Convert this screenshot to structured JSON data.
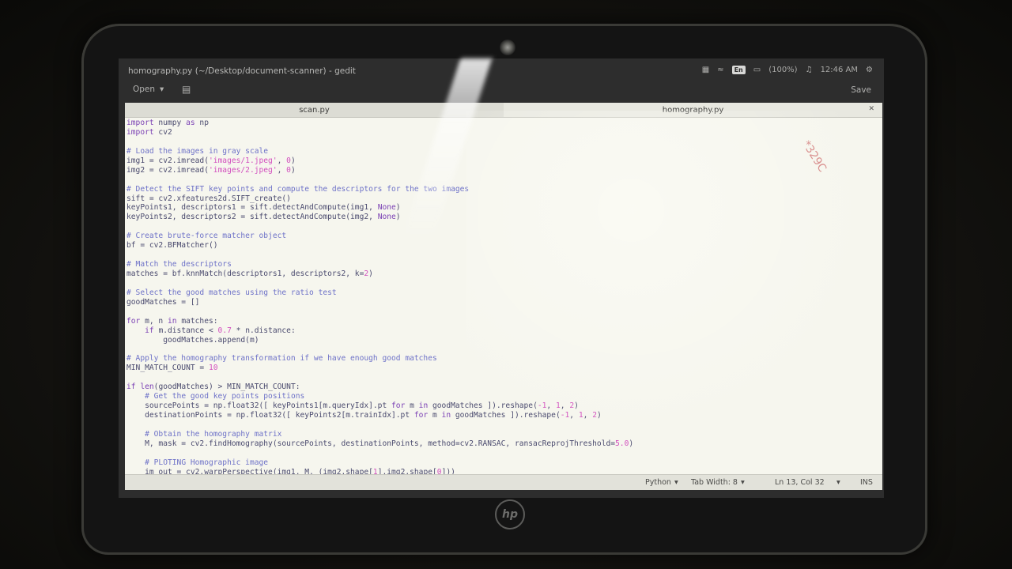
{
  "window": {
    "title": "homography.py (~/Desktop/document-scanner) - gedit"
  },
  "tray": {
    "lang": "En",
    "battery": "(100%)",
    "time": "12:46 AM",
    "icons": [
      "mail-icon",
      "wifi-icon",
      "battery-icon",
      "volume-icon",
      "power-icon"
    ]
  },
  "toolbar": {
    "open_label": "Open",
    "save_label": "Save"
  },
  "tabs": [
    {
      "label": "scan.py"
    },
    {
      "label": "homography.py"
    }
  ],
  "code_lines": [
    [
      [
        "kw",
        "import"
      ],
      [
        "p",
        " numpy "
      ],
      [
        "kw",
        "as"
      ],
      [
        "p",
        " np"
      ]
    ],
    [
      [
        "kw",
        "import"
      ],
      [
        "p",
        " cv2"
      ]
    ],
    [
      [
        "p",
        ""
      ]
    ],
    [
      [
        "cmt",
        "# Load the images in gray scale"
      ]
    ],
    [
      [
        "p",
        "img1 = cv2.imread("
      ],
      [
        "str",
        "'images/1.jpeg'"
      ],
      [
        "p",
        ", "
      ],
      [
        "num",
        "0"
      ],
      [
        "p",
        ")"
      ]
    ],
    [
      [
        "p",
        "img2 = cv2.imread("
      ],
      [
        "str",
        "'images/2.jpeg'"
      ],
      [
        "p",
        ", "
      ],
      [
        "num",
        "0"
      ],
      [
        "p",
        ")"
      ]
    ],
    [
      [
        "p",
        ""
      ]
    ],
    [
      [
        "cmt",
        "# Detect the SIFT key points and compute the descriptors for the two images"
      ]
    ],
    [
      [
        "p",
        "sift = cv2.xfeatures2d.SIFT_create()"
      ]
    ],
    [
      [
        "p",
        "keyPoints1, descriptors1 = sift.detectAndCompute(img1, "
      ],
      [
        "kw",
        "None"
      ],
      [
        "p",
        ")"
      ]
    ],
    [
      [
        "p",
        "keyPoints2, descriptors2 = sift.detectAndCompute(img2, "
      ],
      [
        "kw",
        "None"
      ],
      [
        "p",
        ")"
      ]
    ],
    [
      [
        "p",
        ""
      ]
    ],
    [
      [
        "cmt",
        "# Create brute-force matcher object"
      ]
    ],
    [
      [
        "p",
        "bf = cv2.BFMatcher()"
      ]
    ],
    [
      [
        "p",
        ""
      ]
    ],
    [
      [
        "cmt",
        "# Match the descriptors"
      ]
    ],
    [
      [
        "p",
        "matches = bf.knnMatch(descriptors1, descriptors2, k="
      ],
      [
        "num",
        "2"
      ],
      [
        "p",
        ")"
      ]
    ],
    [
      [
        "p",
        ""
      ]
    ],
    [
      [
        "cmt",
        "# Select the good matches using the ratio test"
      ]
    ],
    [
      [
        "p",
        "goodMatches = []"
      ]
    ],
    [
      [
        "p",
        ""
      ]
    ],
    [
      [
        "kw",
        "for"
      ],
      [
        "p",
        " m, n "
      ],
      [
        "kw",
        "in"
      ],
      [
        "p",
        " matches:"
      ]
    ],
    [
      [
        "p",
        "    "
      ],
      [
        "kw",
        "if"
      ],
      [
        "p",
        " m.distance < "
      ],
      [
        "num",
        "0.7"
      ],
      [
        "p",
        " * n.distance:"
      ]
    ],
    [
      [
        "p",
        "        goodMatches.append(m)"
      ]
    ],
    [
      [
        "p",
        ""
      ]
    ],
    [
      [
        "cmt",
        "# Apply the homography transformation if we have enough good matches"
      ]
    ],
    [
      [
        "p",
        "MIN_MATCH_COUNT = "
      ],
      [
        "num",
        "10"
      ]
    ],
    [
      [
        "p",
        ""
      ]
    ],
    [
      [
        "kw",
        "if"
      ],
      [
        "p",
        " "
      ],
      [
        "kw",
        "len"
      ],
      [
        "p",
        "(goodMatches) > MIN_MATCH_COUNT:"
      ]
    ],
    [
      [
        "p",
        "    "
      ],
      [
        "cmt",
        "# Get the good key points positions"
      ]
    ],
    [
      [
        "p",
        "    sourcePoints = np.float32([ keyPoints1[m.queryIdx].pt "
      ],
      [
        "kw",
        "for"
      ],
      [
        "p",
        " m "
      ],
      [
        "kw",
        "in"
      ],
      [
        "p",
        " goodMatches ]).reshape("
      ],
      [
        "num",
        "-1"
      ],
      [
        "p",
        ", "
      ],
      [
        "num",
        "1"
      ],
      [
        "p",
        ", "
      ],
      [
        "num",
        "2"
      ],
      [
        "p",
        ")"
      ]
    ],
    [
      [
        "p",
        "    destinationPoints = np.float32([ keyPoints2[m.trainIdx].pt "
      ],
      [
        "kw",
        "for"
      ],
      [
        "p",
        " m "
      ],
      [
        "kw",
        "in"
      ],
      [
        "p",
        " goodMatches ]).reshape("
      ],
      [
        "num",
        "-1"
      ],
      [
        "p",
        ", "
      ],
      [
        "num",
        "1"
      ],
      [
        "p",
        ", "
      ],
      [
        "num",
        "2"
      ],
      [
        "p",
        ")"
      ]
    ],
    [
      [
        "p",
        ""
      ]
    ],
    [
      [
        "p",
        "    "
      ],
      [
        "cmt",
        "# Obtain the homography matrix"
      ]
    ],
    [
      [
        "p",
        "    M, mask = cv2.findHomography(sourcePoints, destinationPoints, method=cv2.RANSAC, ransacReprojThreshold="
      ],
      [
        "num",
        "5.0"
      ],
      [
        "p",
        ")"
      ]
    ],
    [
      [
        "p",
        ""
      ]
    ],
    [
      [
        "p",
        "    "
      ],
      [
        "cmt",
        "# PLOTING Homographic image"
      ]
    ],
    [
      [
        "p",
        "    im_out = cv2.warpPerspective(img1, M, (img2.shape["
      ],
      [
        "num",
        "1"
      ],
      [
        "p",
        "],img2.shape["
      ],
      [
        "num",
        "0"
      ],
      [
        "p",
        "]))"
      ]
    ]
  ],
  "statusbar": {
    "language": "Python",
    "tab_width": "Tab Width: 8",
    "position": "Ln 13, Col 32",
    "mode": "INS"
  },
  "sticker_text": "*329C"
}
